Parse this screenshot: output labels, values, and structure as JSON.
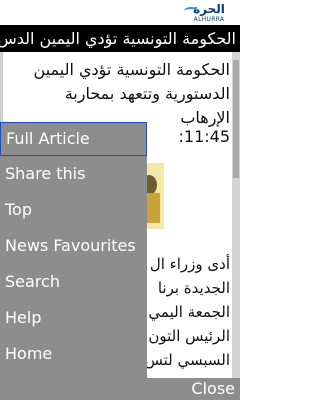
{
  "brand": {
    "arabic": "الحرة",
    "english": "ALHURRA"
  },
  "headline_bar": {
    "text": "الحكومة التونسية تؤدي اليمين الدس"
  },
  "article": {
    "title": "الحكومة التونسية تؤدي اليمين الدستورية وتتعهد بمحاربة الإرهاب",
    "time": ":11:45",
    "body_lines": [
      "أدى وزراء ال",
      "الجديدة برنا",
      "الجمعة اليمي",
      "الرئيس التون",
      "السبسي لتس"
    ]
  },
  "menu": {
    "items": [
      {
        "label": "Full Article",
        "active": true
      },
      {
        "label": "Share this",
        "active": false
      },
      {
        "label": "Top",
        "active": false
      },
      {
        "label": "News Favourites",
        "active": false
      },
      {
        "label": "Search",
        "active": false
      },
      {
        "label": "Help",
        "active": false
      },
      {
        "label": "Home",
        "active": false
      }
    ]
  },
  "bottom_bar": {
    "close_label": "Close"
  },
  "colors": {
    "menu_background": "#8d8d8d",
    "headline_background": "#000000",
    "active_border": "#1f4fbf",
    "brand": "#0a3a86"
  },
  "icons": {
    "brand_logo": "alhurra-logo"
  }
}
